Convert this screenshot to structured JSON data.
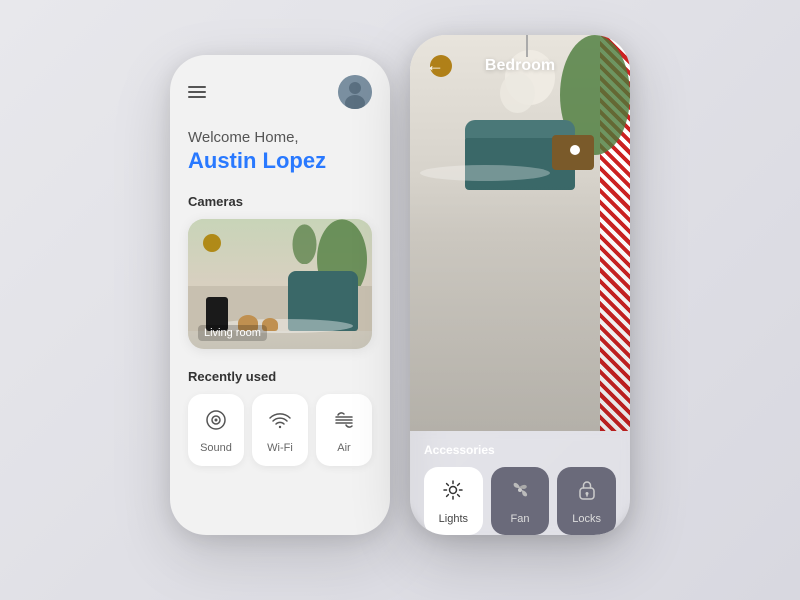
{
  "leftPhone": {
    "header": {
      "menu_icon": "≡",
      "avatar_emoji": "👤"
    },
    "welcome": {
      "greeting": "Welcome Home,",
      "user_name": "Austin Lopez"
    },
    "cameras": {
      "section_title": "Cameras",
      "camera_label": "Living room"
    },
    "recently_used": {
      "section_title": "Recently used",
      "items": [
        {
          "id": "sound",
          "label": "Sound",
          "icon": "◎"
        },
        {
          "id": "wifi",
          "label": "Wi-Fi",
          "icon": "📶"
        },
        {
          "id": "air",
          "label": "Air",
          "icon": "≋"
        }
      ]
    }
  },
  "rightPhone": {
    "room_name": "Bedroom",
    "back_icon": "←",
    "dot": "",
    "accessories": {
      "section_title": "Accessories",
      "items": [
        {
          "id": "lights",
          "label": "Lights",
          "icon": "✦",
          "style": "light"
        },
        {
          "id": "fan",
          "label": "Fan",
          "icon": "✿",
          "style": "dark"
        },
        {
          "id": "locks",
          "label": "Locks",
          "icon": "🔒",
          "style": "dark"
        }
      ]
    }
  }
}
